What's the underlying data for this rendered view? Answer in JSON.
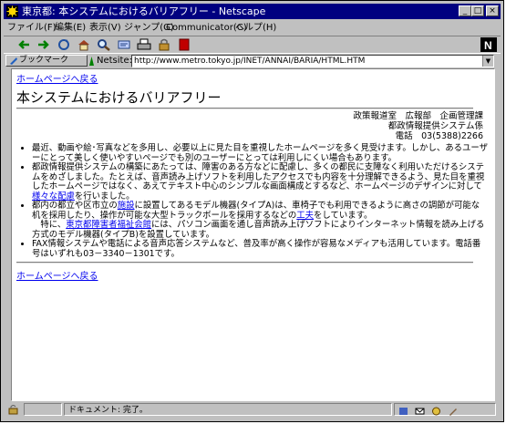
{
  "window": {
    "title": "東京都: 本システムにおけるバリアフリー - Netscape",
    "controls": {
      "minimize": "_",
      "maximize": "□",
      "close": "×"
    }
  },
  "menu": {
    "items": [
      "ファイル(F)",
      "編集(E)",
      "表示(V)",
      "ジャンプ(G)",
      "Communicator(C)",
      "ヘルプ(H)"
    ]
  },
  "location": {
    "bookmarks_label": "ブックマーク",
    "netsite_label": "Netsite:",
    "url": "http://www.metro.tokyo.jp/INET/ANNAI/BARIA/HTML.HTM"
  },
  "page": {
    "home_link": "ホームページへ戻る",
    "title": "本システムにおけるバリアフリー",
    "dept": {
      "line1": "政策報道室　広報部　企画管理課",
      "line2": "都政情報提供システム係",
      "line3": "電話　03(5388)2266"
    },
    "items": {
      "item1": "最近、動画や絵･写真などを多用し、必要以上に見た目を重視したホームページを多く見受けます。しかし、あるユーザーにとって美しく使いやすいページでも別のユーザーにとっては利用しにくい場合もあります。",
      "item2_pre": "都政情報提供システムの構築にあたっては、障害のある方などに配慮し、多くの都民に支障なく利用いただけるシステムをめざしました。たとえば、音声読み上げソフトを利用したアクセスでも内容を十分理解できるよう、見た目を重視したホームページではなく、あえてテキスト中心のシンプルな画面構成とするなど、ホームページのデザインに対して",
      "item2_link": "様々な配慮",
      "item2_post": "を行いました。",
      "item3_pre": "都内の都立や区市立の",
      "item3_link1": "施設",
      "item3_mid1": "に設置してあるモデル機器(タイプA)は、車椅子でも利用できるように高さの調節が可能な机を採用したり、操作が可能な大型トラックボールを採用するなどの",
      "item3_link2": "工夫",
      "item3_mid2": "をしています。",
      "item3_line2_pre": "　特に、",
      "item3_link3": "東京都障害者福祉会館",
      "item3_post": "には、パソコン画面を通し音声読み上げソフトによりインターネット情報を読み上げる方式のモデル機器(タイプB)を設置しています。",
      "item4": "FAX情報システムや電話による音声応答システムなど、普及率が高く操作が容易なメディアも活用しています。電話番号はいずれも03－3340－1301です。"
    },
    "bottom_link": "ホームページへ戻る"
  },
  "status": {
    "text": "ドキュメント: 完了。"
  },
  "colors": {
    "title_bar": "#000080",
    "chrome": "#c0c0c0",
    "link": "#0000ee"
  }
}
